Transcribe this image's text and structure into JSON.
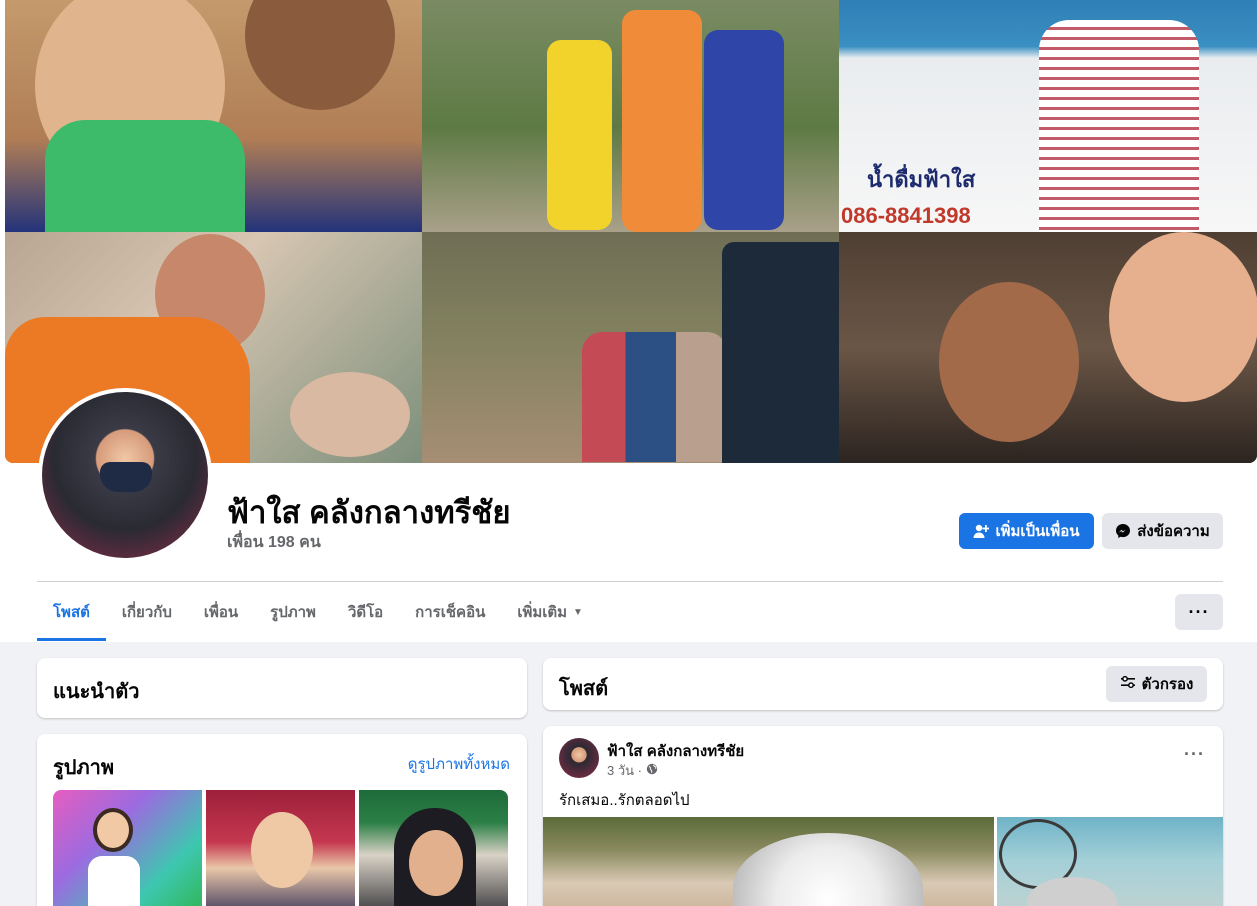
{
  "profile": {
    "name": "ฟ้าใส คลังกลางทรีชัย",
    "friends": "เพื่อน 198 คน"
  },
  "cover": {
    "sign_text": "น้ำดื่มฟ้าใส",
    "sign_phone": "086-8841398"
  },
  "actions": {
    "add_friend": "เพิ่มเป็นเพื่อน",
    "message": "ส่งข้อความ",
    "more": "···"
  },
  "tabs": [
    {
      "label": "โพสต์",
      "active": true
    },
    {
      "label": "เกี่ยวกับ",
      "active": false
    },
    {
      "label": "เพื่อน",
      "active": false
    },
    {
      "label": "รูปภาพ",
      "active": false
    },
    {
      "label": "วิดีโอ",
      "active": false
    },
    {
      "label": "การเช็คอิน",
      "active": false
    },
    {
      "label": "เพิ่มเติม",
      "active": false
    }
  ],
  "intro": {
    "title": "แนะนำตัว"
  },
  "photos": {
    "title": "รูปภาพ",
    "see_all": "ดูรูปภาพทั้งหมด"
  },
  "posts": {
    "title": "โพสต์",
    "filter": "ตัวกรอง"
  },
  "post": {
    "author": "ฟ้าใส คลังกลางทรีชัย",
    "time": "3 วัน ·",
    "text": "รักเสมอ..รักตลอดไป",
    "more": "···"
  },
  "colors": {
    "primary": "#1b74e4",
    "secondary_button": "#e4e6eb",
    "page_bg": "#f0f2f5",
    "muted_text": "#65676b"
  },
  "icons": {
    "add_friend": "person-plus-icon",
    "message": "messenger-icon",
    "filter": "sliders-icon",
    "privacy": "globe-icon",
    "dropdown": "caret-down-icon"
  }
}
